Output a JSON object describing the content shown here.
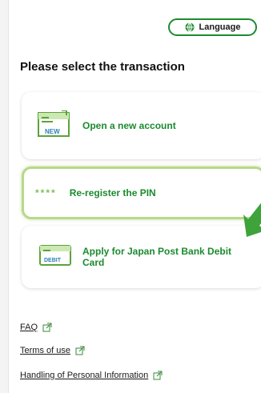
{
  "header": {
    "language_label": "Language"
  },
  "page": {
    "title": "Please select the transaction"
  },
  "transactions": [
    {
      "icon_text": "NEW",
      "label": "Open a new account"
    },
    {
      "mask": "****",
      "label": "Re-register the PIN"
    },
    {
      "icon_text": "DEBIT",
      "label": "Apply for Japan Post Bank Debit Card"
    }
  ],
  "links": {
    "faq": "FAQ",
    "terms": "Terms of use",
    "handling": "Handling of Personal Information"
  },
  "colors": {
    "accent": "#1b8a2f",
    "highlight": "#b8d98a"
  }
}
